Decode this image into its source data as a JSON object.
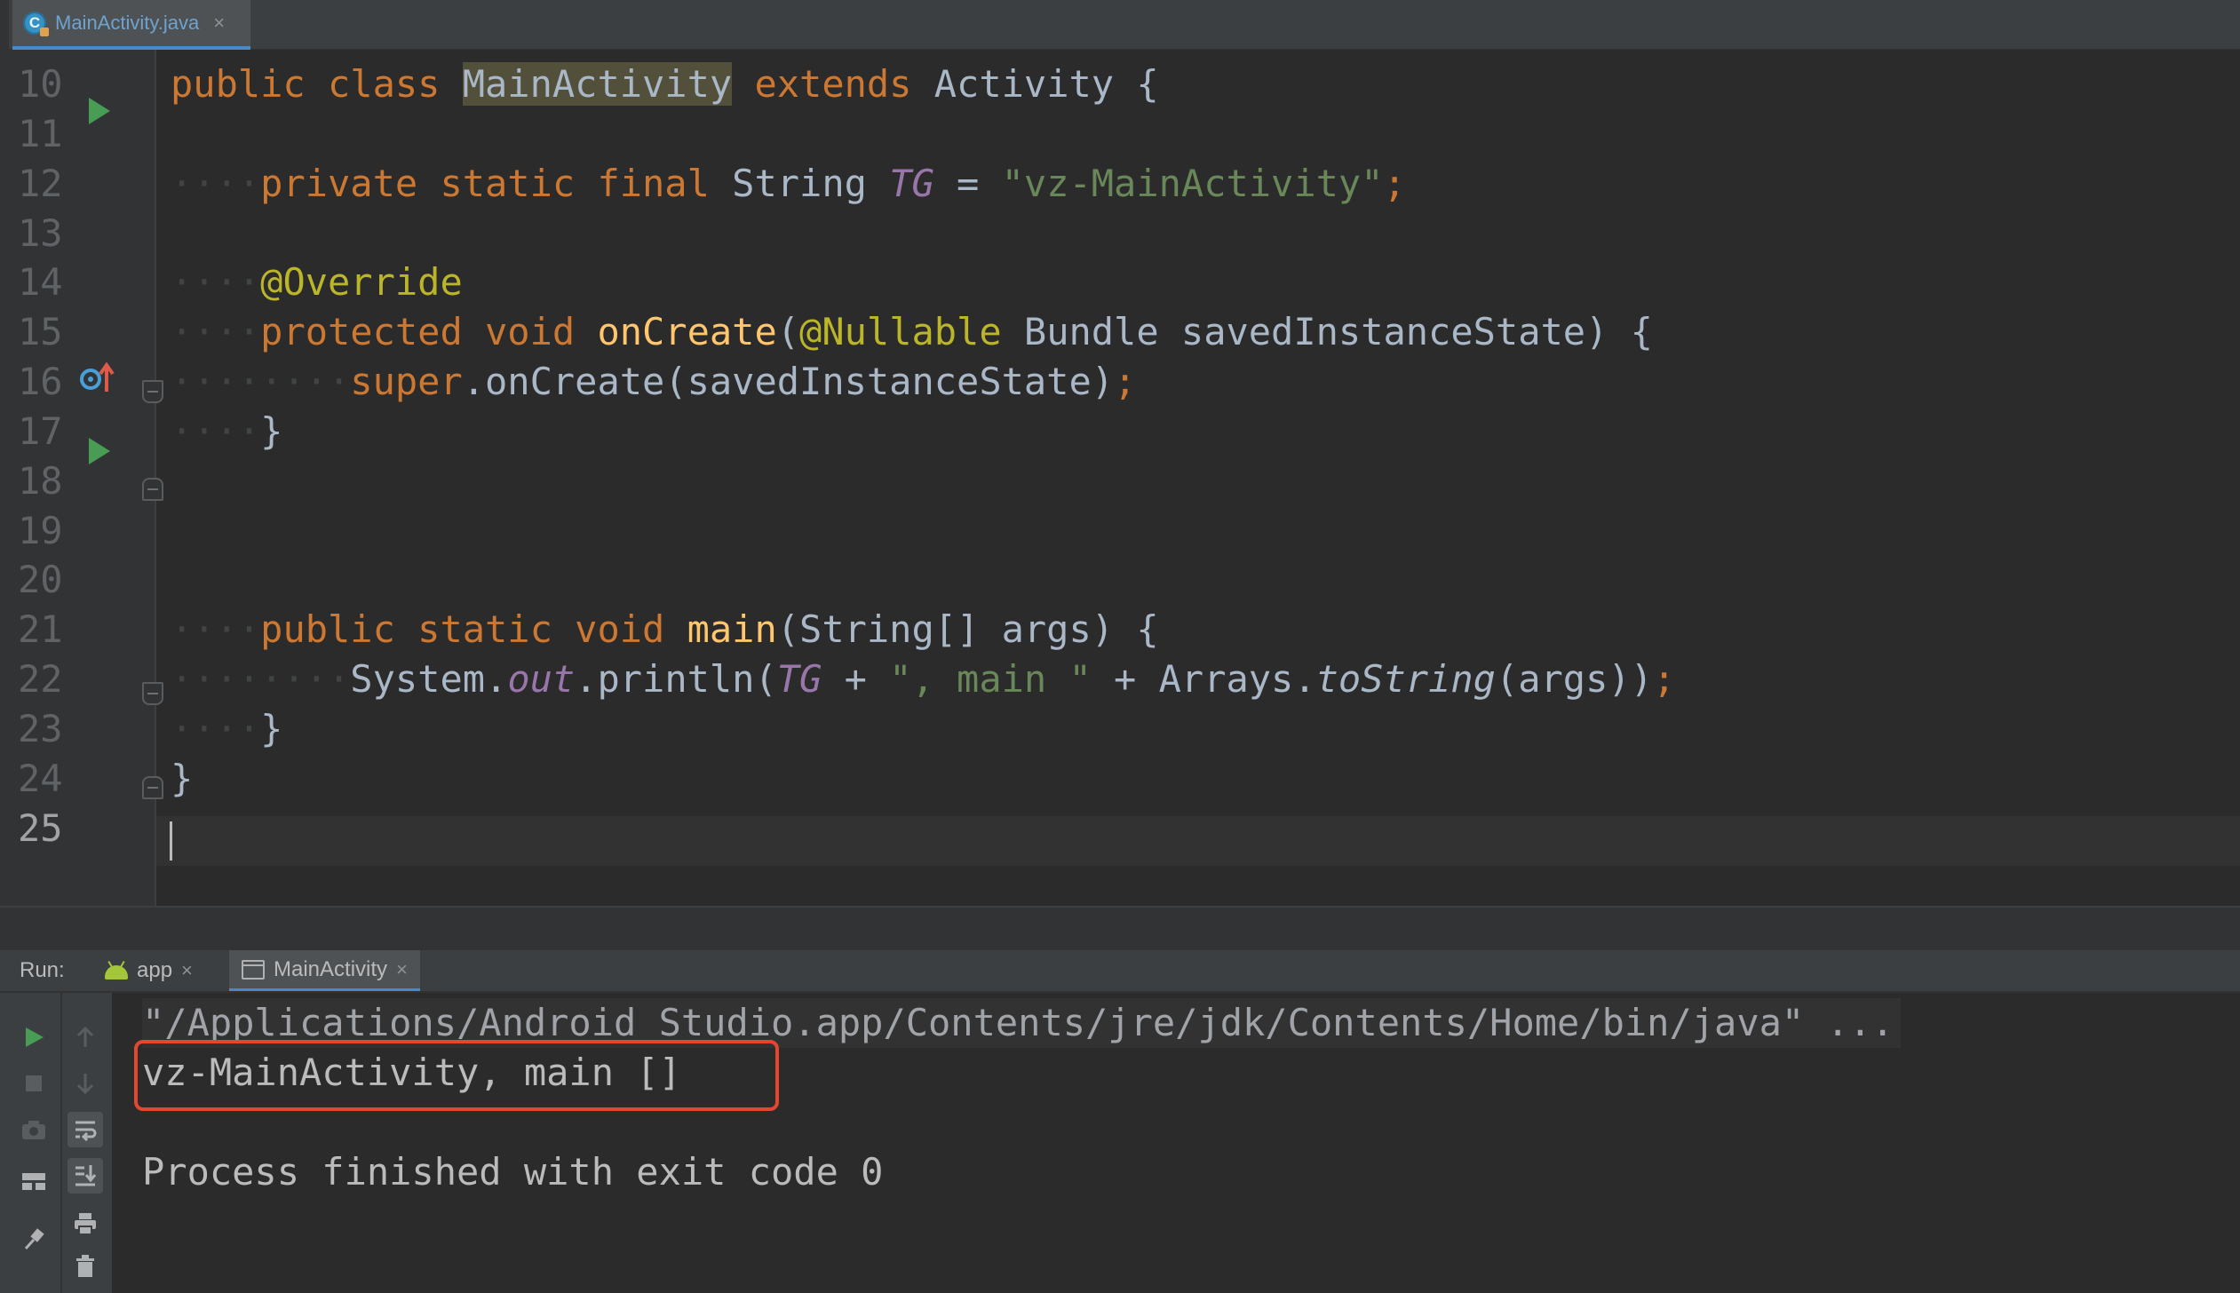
{
  "editor_tab": {
    "filename": "MainActivity.java",
    "close_glyph": "×"
  },
  "code_lines": [
    {
      "num": "10",
      "tokens": [
        {
          "t": "public class ",
          "c": "kw"
        },
        {
          "t": "MainActivity",
          "c": "hl"
        },
        {
          "t": " ",
          "c": ""
        },
        {
          "t": "extends",
          "c": "kw"
        },
        {
          "t": " Activity {",
          "c": ""
        }
      ]
    },
    {
      "num": "11",
      "tokens": []
    },
    {
      "num": "12",
      "tokens": [
        {
          "t": "    ",
          "c": "dot"
        },
        {
          "t": "private static final ",
          "c": "kw"
        },
        {
          "t": "String ",
          "c": ""
        },
        {
          "t": "TG",
          "c": "fld"
        },
        {
          "t": " = ",
          "c": ""
        },
        {
          "t": "\"vz-MainActivity\"",
          "c": "str"
        },
        {
          "t": ";",
          "c": "kw"
        }
      ]
    },
    {
      "num": "13",
      "tokens": []
    },
    {
      "num": "14",
      "tokens": [
        {
          "t": "    ",
          "c": "dot"
        },
        {
          "t": "@Override",
          "c": "ann"
        }
      ]
    },
    {
      "num": "15",
      "tokens": [
        {
          "t": "    ",
          "c": "dot"
        },
        {
          "t": "protected void ",
          "c": "kw"
        },
        {
          "t": "onCreate",
          "c": "fn"
        },
        {
          "t": "(",
          "c": ""
        },
        {
          "t": "@Nullable",
          "c": "ann"
        },
        {
          "t": " Bundle savedInstanceState) {",
          "c": ""
        }
      ]
    },
    {
      "num": "16",
      "tokens": [
        {
          "t": "        ",
          "c": "dot"
        },
        {
          "t": "super",
          "c": "kw"
        },
        {
          "t": ".onCreate(savedInstanceState)",
          "c": ""
        },
        {
          "t": ";",
          "c": "kw"
        }
      ]
    },
    {
      "num": "17",
      "tokens": [
        {
          "t": "    ",
          "c": "dot"
        },
        {
          "t": "}",
          "c": ""
        }
      ]
    },
    {
      "num": "18",
      "tokens": []
    },
    {
      "num": "19",
      "tokens": []
    },
    {
      "num": "20",
      "tokens": []
    },
    {
      "num": "21",
      "tokens": [
        {
          "t": "    ",
          "c": "dot"
        },
        {
          "t": "public static void ",
          "c": "kw"
        },
        {
          "t": "main",
          "c": "fn"
        },
        {
          "t": "(String[] args) {",
          "c": ""
        }
      ]
    },
    {
      "num": "22",
      "tokens": [
        {
          "t": "        ",
          "c": "dot"
        },
        {
          "t": "System.",
          "c": ""
        },
        {
          "t": "out",
          "c": "fld"
        },
        {
          "t": ".println(",
          "c": ""
        },
        {
          "t": "TG",
          "c": "fld"
        },
        {
          "t": " + ",
          "c": ""
        },
        {
          "t": "\", main \"",
          "c": "str"
        },
        {
          "t": " + Arrays.",
          "c": ""
        },
        {
          "t": "toString",
          "c": "stat"
        },
        {
          "t": "(args))",
          "c": ""
        },
        {
          "t": ";",
          "c": "kw"
        }
      ]
    },
    {
      "num": "23",
      "tokens": [
        {
          "t": "    ",
          "c": "dot"
        },
        {
          "t": "}",
          "c": ""
        }
      ]
    },
    {
      "num": "24",
      "tokens": [
        {
          "t": "}",
          "c": ""
        }
      ]
    },
    {
      "num": "25",
      "tokens": []
    }
  ],
  "run_panel": {
    "label": "Run:",
    "tabs": [
      {
        "label": "app",
        "close": "×"
      },
      {
        "label": "MainActivity",
        "close": "×"
      }
    ]
  },
  "console": {
    "command": "\"/Applications/Android Studio.app/Contents/jre/jdk/Contents/Home/bin/java\" ...",
    "output": "vz-MainActivity, main []",
    "blank": "",
    "exit": "Process finished with exit code 0"
  },
  "colors": {
    "keyword": "#cc7832",
    "string": "#6a8759",
    "annotation": "#bbb529",
    "function": "#ffc66d",
    "field": "#9876aa",
    "text": "#a9b7c6",
    "highlight_box": "#e5462f"
  }
}
